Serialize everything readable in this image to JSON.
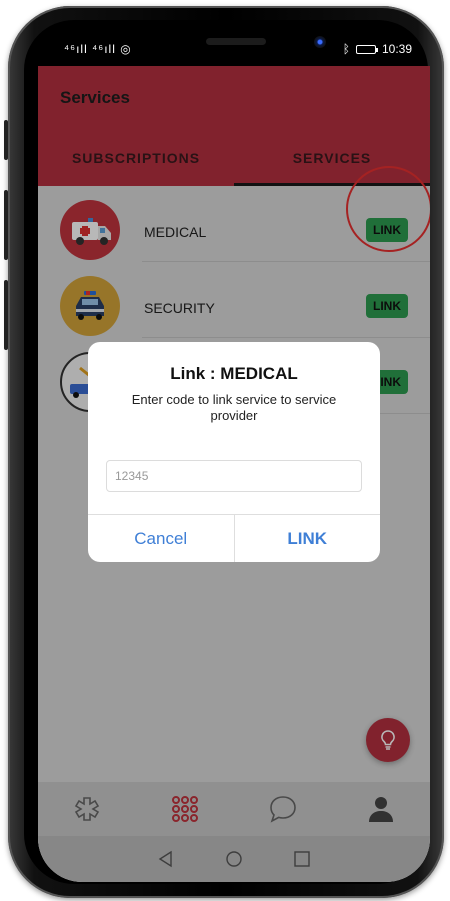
{
  "status": {
    "carrier": "⁴⁶ıll ⁴⁶ıll ◎",
    "time": "10:39"
  },
  "appbar": {
    "title": "Services"
  },
  "tabs": [
    {
      "label": "SUBSCRIPTIONS",
      "active": false
    },
    {
      "label": "SERVICES",
      "active": true
    }
  ],
  "services": [
    {
      "label": "MEDICAL",
      "action": "LINK",
      "icon": "ambulance-icon",
      "color": "#c0343d"
    },
    {
      "label": "SECURITY",
      "action": "LINK",
      "icon": "police-car-icon",
      "color": "#d2a23a"
    },
    {
      "label": "",
      "action": "LINK",
      "icon": "tow-truck-icon",
      "color": "#f2f2f2"
    }
  ],
  "dialog": {
    "title": "Link : MEDICAL",
    "message": "Enter code to link service to service provider",
    "input_value": "12345",
    "cancel_label": "Cancel",
    "confirm_label": "LINK"
  },
  "colors": {
    "brand": "#b3303f",
    "link_green": "#2d9a4f",
    "dialog_button": "#3f7fd6"
  }
}
